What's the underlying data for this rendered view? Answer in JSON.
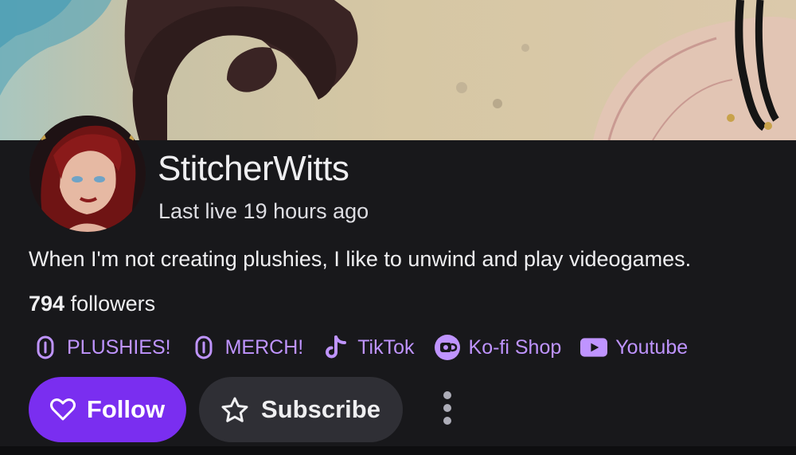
{
  "channel": {
    "name": "StitcherWitts",
    "last_live": "Last live 19 hours ago",
    "bio": "When I'm not creating plushies, I like to unwind and play videogames.",
    "followers_count": "794",
    "followers_label": "followers"
  },
  "links": [
    {
      "label": "PLUSHIES!",
      "icon": "link-icon"
    },
    {
      "label": "MERCH!",
      "icon": "link-icon"
    },
    {
      "label": "TikTok",
      "icon": "tiktok-icon"
    },
    {
      "label": "Ko-fi Shop",
      "icon": "kofi-icon"
    },
    {
      "label": "Youtube",
      "icon": "youtube-icon"
    }
  ],
  "actions": {
    "follow_label": "Follow",
    "subscribe_label": "Subscribe"
  },
  "colors": {
    "background": "#18181b",
    "accent_purple": "#7a2ef0",
    "link_purple": "#bf94ff",
    "secondary_button": "#2f2f35",
    "text": "#efeff1"
  }
}
